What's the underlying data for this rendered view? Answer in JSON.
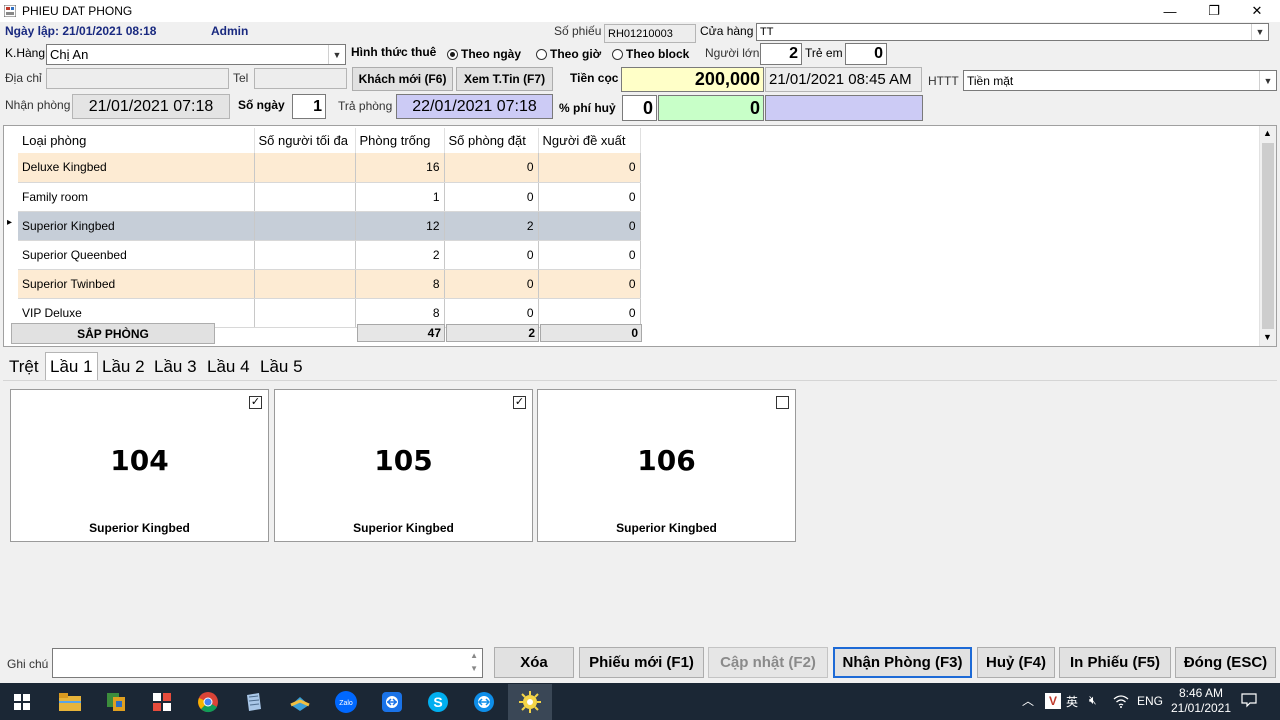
{
  "window": {
    "title": "PHIEU DAT PHONG",
    "minimize_glyph": "—",
    "restore_glyph": "❐",
    "close_glyph": "✕"
  },
  "header": {
    "ngay_lap_label": "Ngày lập: 21/01/2021 08:18",
    "user": "Admin",
    "so_phieu_label": "Số phiếu",
    "so_phieu_value": "RH01210003",
    "cua_hang_label": "Cửa hàng",
    "cua_hang_value": "TT",
    "khang_label": "K.Hàng",
    "khang_value": "Chị An",
    "hinh_thuc_label": "Hình thức thuê",
    "radio_day": "Theo ngày",
    "radio_hour": "Theo giờ",
    "radio_block": "Theo block",
    "nguoi_lon_label": "Người lớn",
    "nguoi_lon_value": "2",
    "tre_em_label": "Trẻ em",
    "tre_em_value": "0",
    "dia_chi_label": "Địa chỉ",
    "tel_label": "Tel",
    "khach_moi_btn": "Khách mới (F6)",
    "xem_ttin_btn": "Xem T.Tin (F7)",
    "tien_coc_label": "Tiền cọc",
    "tien_coc_value": "200,000",
    "tien_coc_time": "21/01/2021 08:45 AM",
    "httt_label": "HTTT",
    "httt_value": "Tiền mặt",
    "nhan_phong_label": "Nhận phòng",
    "nhan_phong_value": "21/01/2021 07:18",
    "so_ngay_label": "Số ngày",
    "so_ngay_value": "1",
    "tra_phong_label": "Trả phòng",
    "tra_phong_value": "22/01/2021 07:18",
    "phi_huy_label": "% phí huỷ",
    "phi_huy_pct": "0",
    "phi_huy_amount": "0"
  },
  "grid": {
    "columns": [
      "Loại phòng",
      "Số người tối đa",
      "Phòng trống",
      "Số phòng đặt",
      "Người đề xuất"
    ],
    "rows": [
      {
        "type": "Deluxe Kingbed",
        "max": "",
        "free": "16",
        "booked": "0",
        "suggest": "0"
      },
      {
        "type": "Family room",
        "max": "",
        "free": "1",
        "booked": "0",
        "suggest": "0"
      },
      {
        "type": "Superior Kingbed",
        "max": "",
        "free": "12",
        "booked": "2",
        "suggest": "0"
      },
      {
        "type": "Superior Queenbed",
        "max": "",
        "free": "2",
        "booked": "0",
        "suggest": "0"
      },
      {
        "type": "Superior Twinbed",
        "max": "",
        "free": "8",
        "booked": "0",
        "suggest": "0"
      },
      {
        "type": "VIP Deluxe",
        "max": "",
        "free": "8",
        "booked": "0",
        "suggest": "0"
      }
    ],
    "row_marker": "▸",
    "sap_phong_btn": "SẮP PHÒNG",
    "totals": {
      "free": "47",
      "booked": "2",
      "suggest": "0"
    }
  },
  "floors": {
    "tabs": [
      "Trệt",
      "Lầu 1",
      "Lầu 2",
      "Lầu 3",
      "Lầu 4",
      "Lầu 5"
    ]
  },
  "rooms": [
    {
      "number": "104",
      "type": "Superior Kingbed",
      "mark": "✓"
    },
    {
      "number": "105",
      "type": "Superior Kingbed",
      "mark": "✓"
    },
    {
      "number": "106",
      "type": "Superior Kingbed",
      "mark": ""
    }
  ],
  "footer": {
    "ghi_chu_label": "Ghi chú",
    "xoa_btn": "Xóa",
    "phieu_moi_btn": "Phiếu mới (F1)",
    "cap_nhat_btn": "Cập nhật (F2)",
    "nhan_phong_btn": "Nhận Phòng (F3)",
    "huy_btn": "Huỷ (F4)",
    "in_phieu_btn": "In Phiếu (F5)",
    "dong_btn": "Đóng (ESC)"
  },
  "taskbar": {
    "lang": "ENG",
    "time": "8:46 AM",
    "date": "21/01/2021",
    "zalo_label": "Zalo"
  },
  "colors": {
    "tien_coc_bg": "#ffffc8",
    "phi_huy_amount_bg": "#c8ffc8",
    "date_field_bg": "#cccbf5",
    "row_alt": "#fdebd3",
    "row_selected": "#c6ced8",
    "taskbar": "#1b2735"
  }
}
